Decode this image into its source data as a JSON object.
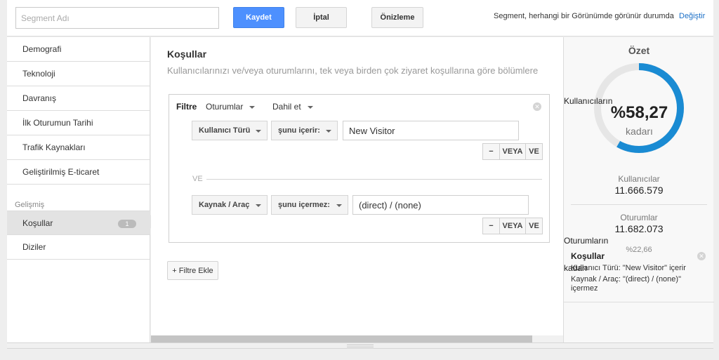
{
  "topbar": {
    "segment_placeholder": "Segment Adı",
    "save_label": "Kaydet",
    "cancel_label": "İptal",
    "preview_label": "Önizleme",
    "visibility_text": "Segment, herhangi bir Görünümde görünür durumda",
    "change_link": "Değiştir"
  },
  "sidebar": {
    "items": [
      {
        "label": "Demografi"
      },
      {
        "label": "Teknoloji"
      },
      {
        "label": "Davranış"
      },
      {
        "label": "İlk Oturumun Tarihi"
      },
      {
        "label": "Trafik Kaynakları"
      },
      {
        "label": "Geliştirilmiş E-ticaret"
      }
    ],
    "advanced_section": "Gelişmiş",
    "advanced_items": [
      {
        "label": "Koşullar",
        "badge": "1",
        "active": true
      },
      {
        "label": "Diziler"
      }
    ]
  },
  "main": {
    "title": "Koşullar",
    "subtitle": "Kullanıcılarınızı ve/veya oturumlarını, tek veya birden çok ziyaret koşullarına göre bölümlere",
    "filter": {
      "label": "Filtre",
      "scope": "Oturumlar",
      "mode": "Dahil et",
      "conditions": [
        {
          "dimension": "Kullanıcı Türü",
          "operator": "şunu içerir:",
          "value": "New Visitor"
        },
        {
          "dimension": "Kaynak / Araç",
          "operator": "şunu içermez:",
          "value": "(direct) / (none)"
        }
      ],
      "minus_label": "−",
      "or_label": "VEYA",
      "and_label": "VE",
      "separator_label": "VE"
    },
    "add_filter_label": "+ Filtre Ekle"
  },
  "summary": {
    "title": "Özet",
    "users_overlay": "Kullanıcıların",
    "percent": "%58,27",
    "percent_fraction": 0.5827,
    "kadari": "kadarı",
    "users_label": "Kullanıcılar",
    "users_value": "11.666.579",
    "sessions_label": "Oturumlar",
    "sessions_value": "11.682.073",
    "sessions_overlay": "Oturumların",
    "sessions_pct": "%22,66",
    "sessions_kadari": "kadarı",
    "conditions_title": "Koşullar",
    "condition_lines": [
      "Kullanıcı Türü: \"New Visitor\" içerir",
      "Kaynak / Araç: \"(direct) / (none)\" içermez"
    ]
  },
  "colors": {
    "accent": "#1a8bd3",
    "primary_button": "#4d90fe",
    "link": "#1a6fc7"
  }
}
